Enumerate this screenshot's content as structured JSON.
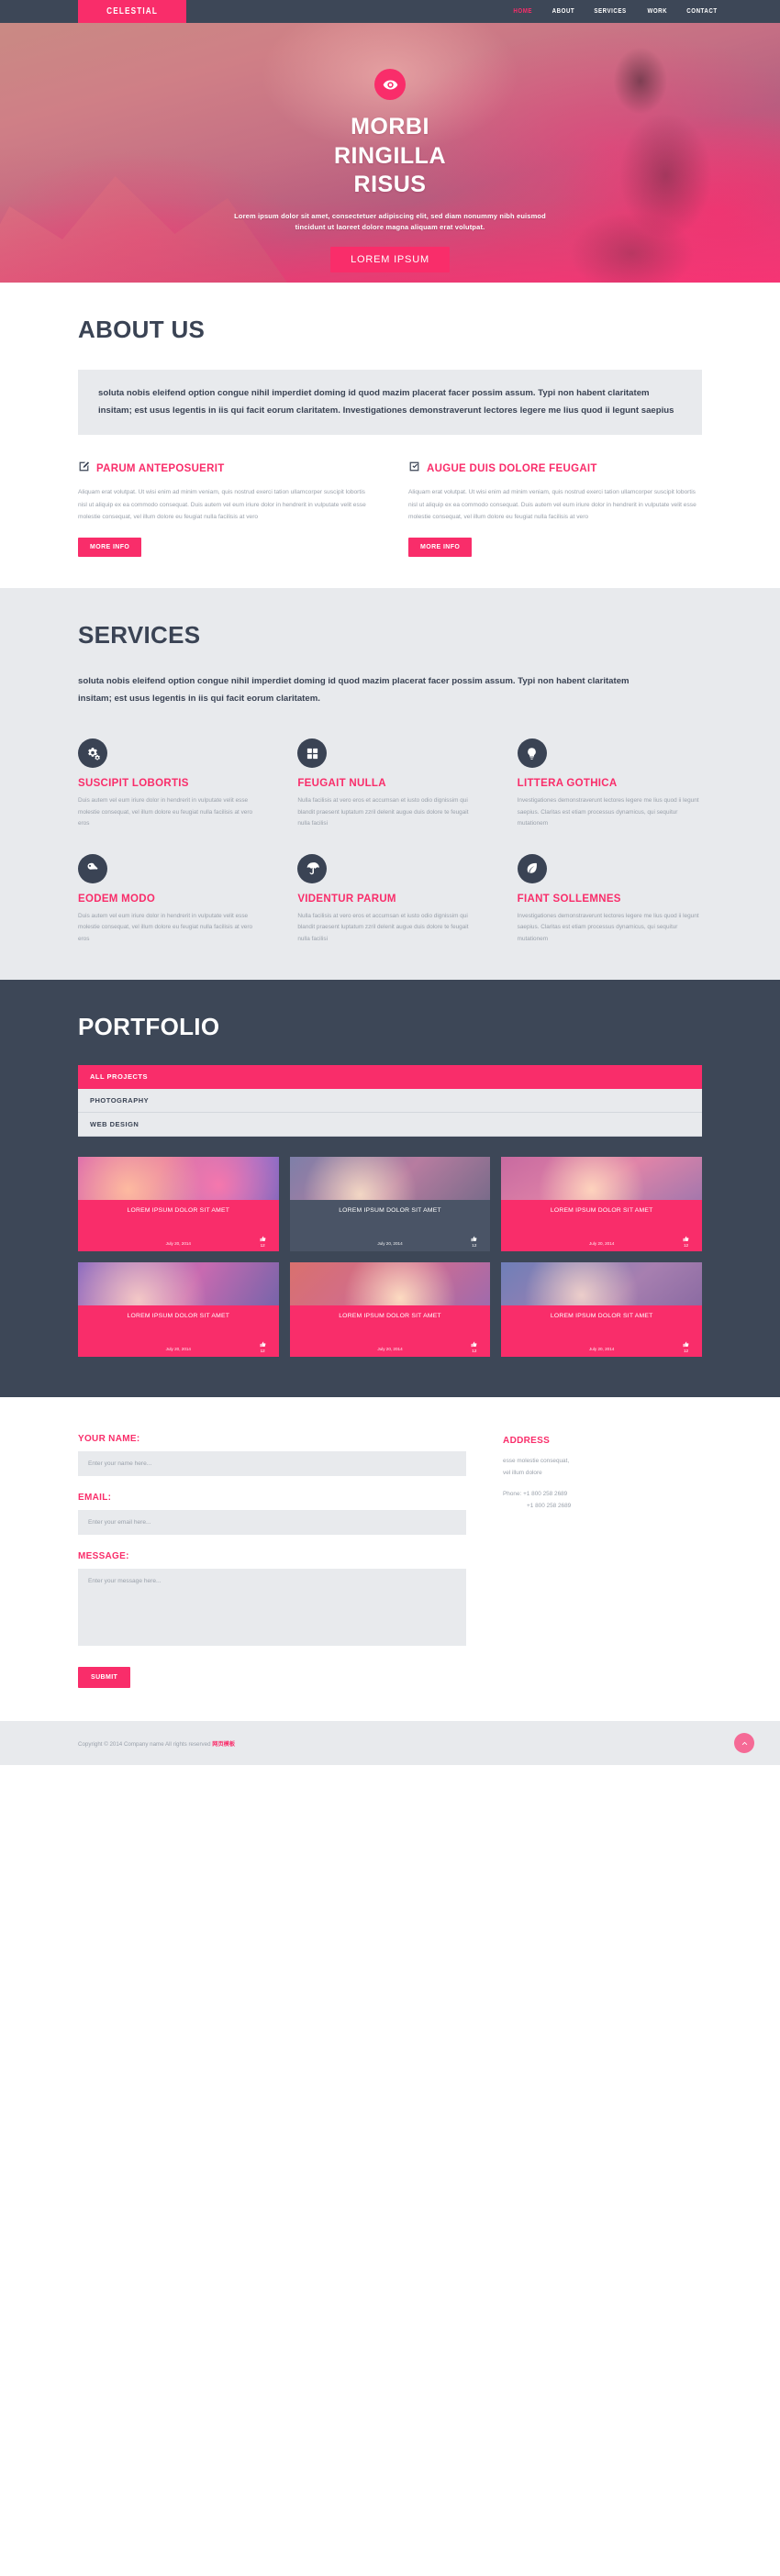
{
  "header": {
    "logo": "CELESTIAL",
    "nav": [
      {
        "label": "HOME",
        "active": true
      },
      {
        "label": "ABOUT",
        "active": false
      },
      {
        "label": "SERVICES",
        "active": false
      },
      {
        "label": "WORK",
        "active": false
      },
      {
        "label": "CONTACT",
        "active": false
      }
    ]
  },
  "hero": {
    "icon": "eye-icon",
    "title_line1": "MORBI",
    "title_line2": "RINGILLA",
    "title_line3": "RISUS",
    "subtitle": "Lorem ipsum dolor sit amet, consectetuer adipiscing elit, sed diam nonummy nibh euismod tincidunt ut laoreet dolore magna aliquam erat volutpat.",
    "button": "LOREM IPSUM",
    "accent": "#f92d6a"
  },
  "about": {
    "title": "ABOUT US",
    "intro": "soluta nobis eleifend option congue nihil imperdiet doming id quod mazim placerat facer possim assum. Typi non habent claritatem insitam; est usus legentis in iis qui facit eorum claritatem. Investigationes demonstraverunt lectores legere me lius quod ii legunt saepius",
    "columns": [
      {
        "icon": "pencil-square-icon",
        "title": "PARUM ANTEPOSUERIT",
        "body": "Aliquam erat volutpat. Ut wisi enim ad minim veniam, quis nostrud exerci tation ullamcorper suscipit lobortis nisl ut aliquip ex ea commodo consequat. Duis autem vel eum iriure dolor in hendrerit in vulputate velit esse molestie consequat, vel illum dolore eu feugiat nulla facilisis at vero",
        "button": "MORE INFO"
      },
      {
        "icon": "check-square-icon",
        "title": "AUGUE DUIS DOLORE FEUGAIT",
        "body": "Aliquam erat volutpat. Ut wisi enim ad minim veniam, quis nostrud exerci tation ullamcorper suscipit lobortis nisl ut aliquip ex ea commodo consequat. Duis autem vel eum iriure dolor in hendrerit in vulputate velit esse molestie consequat, vel illum dolore eu feugiat nulla facilisis at vero",
        "button": "MORE INFO"
      }
    ]
  },
  "services": {
    "title": "SERVICES",
    "lead": "soluta nobis eleifend option congue nihil imperdiet doming id quod mazim placerat facer possim assum. Typi non habent claritatem insitam; est usus legentis in iis qui facit eorum claritatem.",
    "items": [
      {
        "icon": "gears-icon",
        "title": "SUSCIPIT LOBORTIS",
        "body": "Duis autem vel eum iriure dolor in hendrerit in vulputate velit esse molestie consequat, vel illum dolore eu feugiat nulla facilisis at vero eros"
      },
      {
        "icon": "grid-icon",
        "title": "FEUGAIT NULLA",
        "body": "Nulla facilisis at vero eros et accumsan et iusto odio dignissim qui blandit praesent luptatum zzril delenit augue duis dolore te feugait nulla facilisi"
      },
      {
        "icon": "lightbulb-icon",
        "title": "LITTERA GOTHICA",
        "body": "Investigationes demonstraverunt lectores legere me lius quod ii legunt saepius. Claritas est etiam processus dynamicus, qui sequitur mutationem"
      },
      {
        "icon": "key-icon",
        "title": "EODEM MODO",
        "body": "Duis autem vel eum iriure dolor in hendrerit in vulputate velit esse molestie consequat, vel illum dolore eu feugiat nulla facilisis at vero eros"
      },
      {
        "icon": "umbrella-icon",
        "title": "VIDENTUR PARUM",
        "body": "Nulla facilisis at vero eros et accumsan et iusto odio dignissim qui blandit praesent luptatum zzril delenit augue duis dolore te feugait nulla facilisi"
      },
      {
        "icon": "leaf-icon",
        "title": "FIANT SOLLEMNES",
        "body": "Investigationes demonstraverunt lectores legere me lius quod ii legunt saepius. Claritas est etiam processus dynamicus, qui sequitur mutationem"
      }
    ]
  },
  "portfolio": {
    "title": "PORTFOLIO",
    "filters": [
      {
        "label": "ALL PROJECTS",
        "active": true
      },
      {
        "label": "PHOTOGRAPHY",
        "active": false
      },
      {
        "label": "WEB DESIGN",
        "active": false
      }
    ],
    "items": [
      {
        "name": "LOREM IPSUM DOLOR SIT AMET",
        "date": "July 20, 2014",
        "likes": "12",
        "overlay": "pink",
        "thumb": "tn1"
      },
      {
        "name": "LOREM IPSUM DOLOR SIT AMET",
        "date": "July 20, 2014",
        "likes": "12",
        "overlay": "dark",
        "thumb": "tn2"
      },
      {
        "name": "LOREM IPSUM DOLOR SIT AMET",
        "date": "July 20, 2014",
        "likes": "12",
        "overlay": "pink",
        "thumb": "tn3"
      },
      {
        "name": "LOREM IPSUM DOLOR SIT AMET",
        "date": "July 20, 2014",
        "likes": "12",
        "overlay": "pink",
        "thumb": "tn4"
      },
      {
        "name": "LOREM IPSUM DOLOR SIT AMET",
        "date": "July 20, 2014",
        "likes": "12",
        "overlay": "pink",
        "thumb": "tn5"
      },
      {
        "name": "LOREM IPSUM DOLOR SIT AMET",
        "date": "July 20, 2014",
        "likes": "12",
        "overlay": "pink",
        "thumb": "tn6"
      }
    ]
  },
  "contact": {
    "name_label": "YOUR NAME:",
    "name_placeholder": "Enter your name here...",
    "email_label": "EMAIL:",
    "email_placeholder": "Enter your email here...",
    "message_label": "MESSAGE:",
    "message_placeholder": "Enter your message here...",
    "submit": "SUBMIT",
    "address_title": "ADDRESS",
    "address_line1": "esse molestie consequat,",
    "address_line2": "vel illum dolore",
    "phone1": "Phone: +1 800 258 2689",
    "phone2": "+1 800 258 2689"
  },
  "footer": {
    "copyright": "Copyright © 2014 Company name All rights reserved ",
    "credit": "网页模板",
    "to_top_icon": "chevron-up-icon"
  }
}
